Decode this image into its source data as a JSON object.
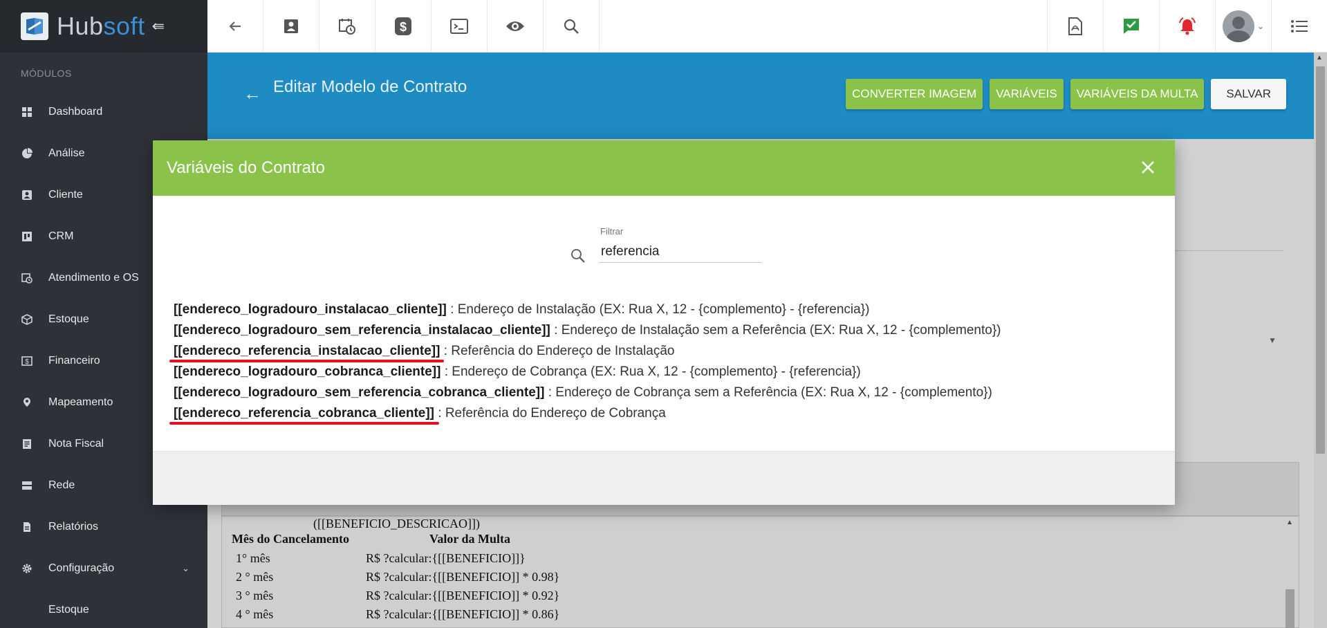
{
  "app": {
    "brand_prefix": "Hub",
    "brand_suffix": "soft"
  },
  "sidebar": {
    "section_label": "MÓDULOS",
    "items": [
      {
        "label": "Dashboard"
      },
      {
        "label": "Análise"
      },
      {
        "label": "Cliente"
      },
      {
        "label": "CRM"
      },
      {
        "label": "Atendimento e OS"
      },
      {
        "label": "Estoque"
      },
      {
        "label": "Financeiro"
      },
      {
        "label": "Mapeamento"
      },
      {
        "label": "Nota Fiscal"
      },
      {
        "label": "Rede"
      },
      {
        "label": "Relatórios"
      },
      {
        "label": "Configuração"
      }
    ],
    "sub_item": "Estoque"
  },
  "page": {
    "title": "Editar Modelo de Contrato",
    "actions": {
      "convert": "CONVERTER IMAGEM",
      "variables": "VARIÁVEIS",
      "fine_variables": "VARIÁVEIS DA MULTA",
      "save": "SALVAR"
    }
  },
  "editor": {
    "benefit_line": "([[BENEFICIO_DESCRICAO]])",
    "col_month": "Mês do Cancelamento",
    "col_value": "Valor da Multa",
    "rows": [
      {
        "month": "1° mês",
        "value": "R$ ?calcular:{[[BENEFICIO]]}"
      },
      {
        "month": "2 ° mês",
        "value": "R$ ?calcular:{[[BENEFICIO]] * 0.98}"
      },
      {
        "month": "3 ° mês",
        "value": "R$ ?calcular:{[[BENEFICIO]] * 0.92}"
      },
      {
        "month": "4 ° mês",
        "value": "R$ ?calcular:{[[BENEFICIO]] * 0.86}"
      }
    ]
  },
  "modal": {
    "title": "Variáveis do Contrato",
    "filter_label": "Filtrar",
    "filter_value": "referencia",
    "variables": [
      {
        "key": "[[endereco_logradouro_instalacao_cliente]]",
        "desc": " : Endereço de Instalação (EX: Rua X, 12 - {complemento} - {referencia})"
      },
      {
        "key": "[[endereco_logradouro_sem_referencia_instalacao_cliente]]",
        "desc": " : Endereço de Instalação sem a Referência (EX: Rua X, 12 - {complemento})"
      },
      {
        "key": "[[endereco_referencia_instalacao_cliente]]",
        "desc": " : Referência do Endereço de Instalação"
      },
      {
        "key": "[[endereco_logradouro_cobranca_cliente]]",
        "desc": " : Endereço de Cobrança (EX: Rua X, 12 - {complemento} - {referencia})"
      },
      {
        "key": "[[endereco_logradouro_sem_referencia_cobranca_cliente]]",
        "desc": " : Endereço de Cobrança sem a Referência (EX: Rua X, 12 - {complemento})"
      },
      {
        "key": "[[endereco_referencia_cobranca_cliente]]",
        "desc": " : Referência do Endereço de Cobrança"
      }
    ]
  },
  "colors": {
    "sidebar_bg": "#2e3238",
    "header_blue": "#1e8bc3",
    "accent_green": "#8bc34a",
    "highlight_red": "#e8101e"
  }
}
